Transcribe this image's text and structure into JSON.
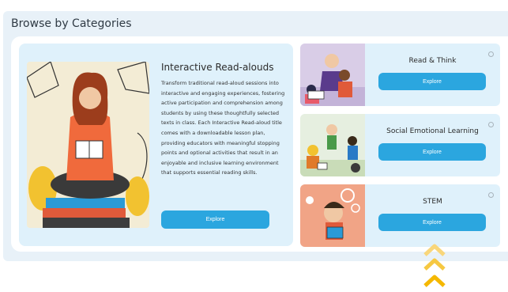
{
  "section": {
    "title": "Browse by Categories"
  },
  "featured": {
    "title": "Interactive Read-alouds",
    "description": "Transform traditional read-aloud sessions into interactive and engaging experiences, fostering active participation and comprehension among students by using these thoughtfully selected texts in class. Each Interactive Read-aloud title comes with a downloadable lesson plan, providing educators with meaningful stopping points and optional activities that result in an enjoyable and inclusive learning environment that supports essential reading skills.",
    "button_label": "Explore"
  },
  "categories": [
    {
      "title": "Read & Think",
      "button_label": "Explore"
    },
    {
      "title": "Social Emotional Learning",
      "button_label": "Explore"
    },
    {
      "title": "STEM",
      "button_label": "Explore"
    }
  ],
  "colors": {
    "accent": "#2ba6df",
    "card_bg": "#dff1fb",
    "panel_bg": "#e8f1f8",
    "chevron": "#f5c518"
  }
}
